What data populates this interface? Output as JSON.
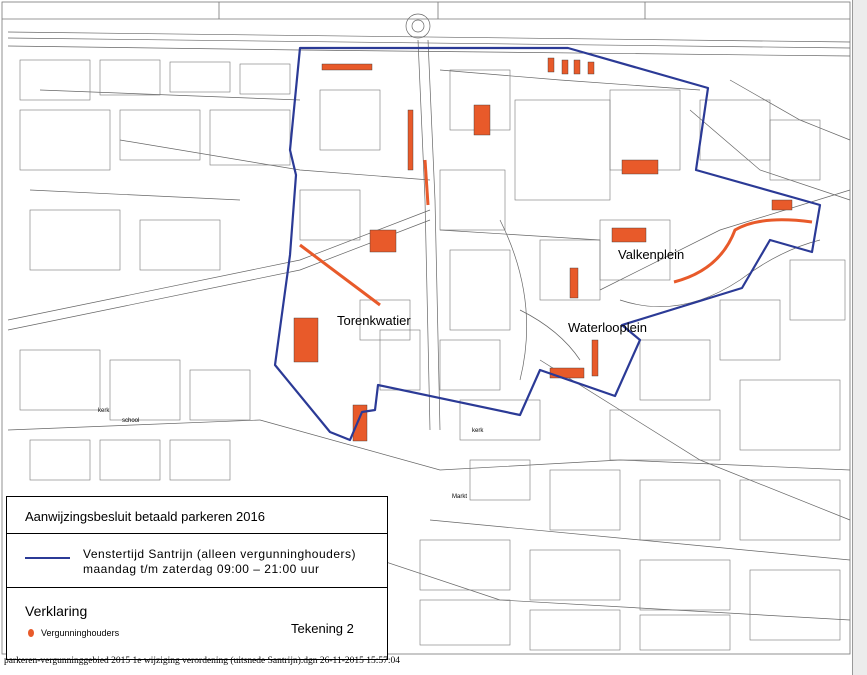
{
  "map": {
    "colors": {
      "zone_boundary": "#2b3a96",
      "permit_holder_marker": "#e85a2a",
      "street_lines": "#555555",
      "background": "#ffffff"
    },
    "place_labels": {
      "torenkwatier": "Torenkwatier",
      "valkenplein": "Valkenplein",
      "waterlooplein": "Waterlooplein"
    },
    "minor_labels": {
      "kerk_1": "kerk",
      "school": "school",
      "kerk_2": "kerk",
      "markt": "Markt"
    }
  },
  "legend": {
    "title": "Aanwijzingsbesluit betaald  parkeren 2016",
    "zone_line_1": "Venstertijd Santrijn  (alleen vergunninghouders)",
    "zone_line_2": "maandag  t/m  zaterdag 09:00  –  21:00  uur",
    "section_heading": "Verklaring",
    "marker_label": "Vergunninghouders",
    "drawing_label": "Tekening  2"
  },
  "footer": {
    "file_info": "parkeren-vergunninggebied 2015 1e wijziging verordening (uitsnede Santrijn).dgn 26-11-2015 15:57:04"
  }
}
